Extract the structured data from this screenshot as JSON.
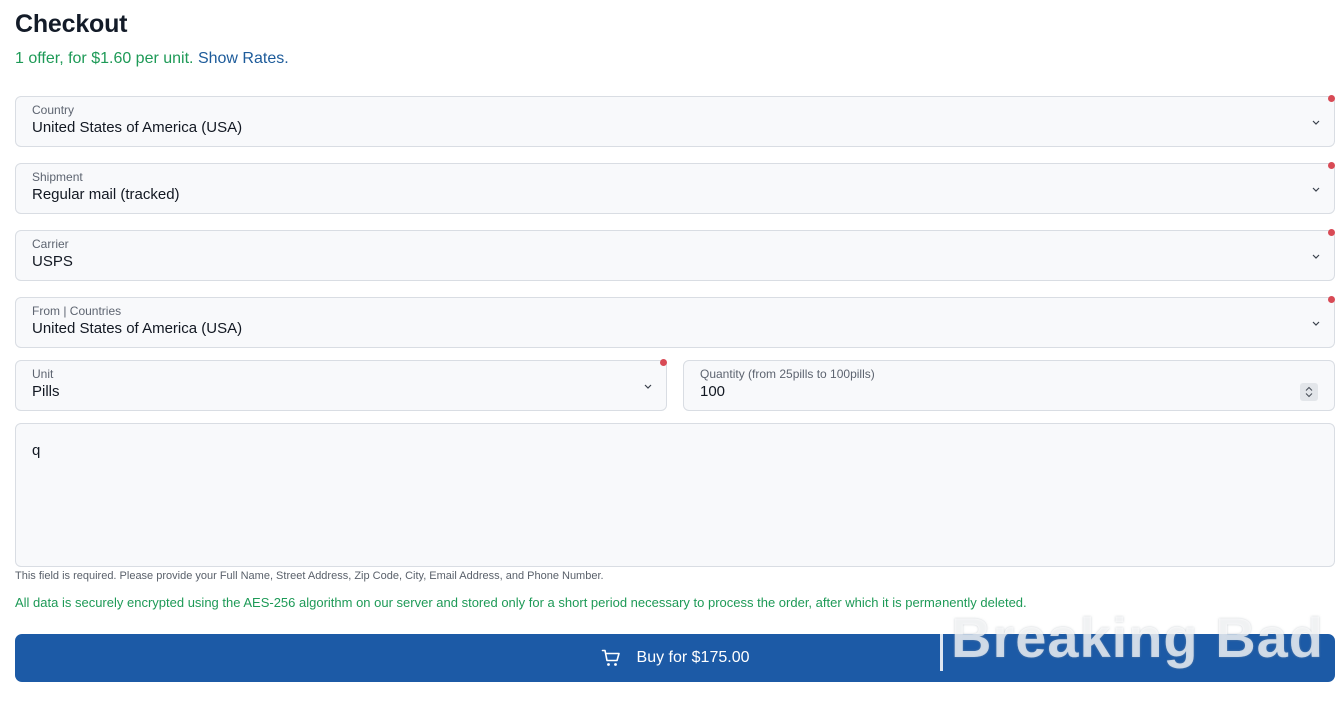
{
  "page": {
    "title": "Checkout",
    "offer_text": "1 offer, for $1.60 per unit.",
    "show_rates_link": "Show Rates."
  },
  "form": {
    "country": {
      "label": "Country",
      "value": "United States of America (USA)"
    },
    "shipment": {
      "label": "Shipment",
      "value": "Regular mail (tracked)"
    },
    "carrier": {
      "label": "Carrier",
      "value": "USPS"
    },
    "from_countries": {
      "label": "From | Countries",
      "value": "United States of America (USA)"
    },
    "unit": {
      "label": "Unit",
      "value": "Pills"
    },
    "quantity": {
      "label": "Quantity (from 25pills to 100pills)",
      "value": "100"
    },
    "address": {
      "value": "q"
    }
  },
  "hint_text": "This field is required. Please provide your Full Name, Street Address, Zip Code, City, Email Address, and Phone Number.",
  "security_text": "All data is securely encrypted using the AES-256 algorithm on our server and stored only for a short period necessary to process the order, after which it is permanently deleted.",
  "buy_button": {
    "label": "Buy for $175.00",
    "icon": "cart-icon"
  },
  "watermark_text": "Breaking Bad",
  "colors": {
    "accent_green": "#1e9a57",
    "link_blue": "#1d5b9a",
    "button_blue": "#1c5aa6",
    "required_dot": "#d84a55"
  }
}
